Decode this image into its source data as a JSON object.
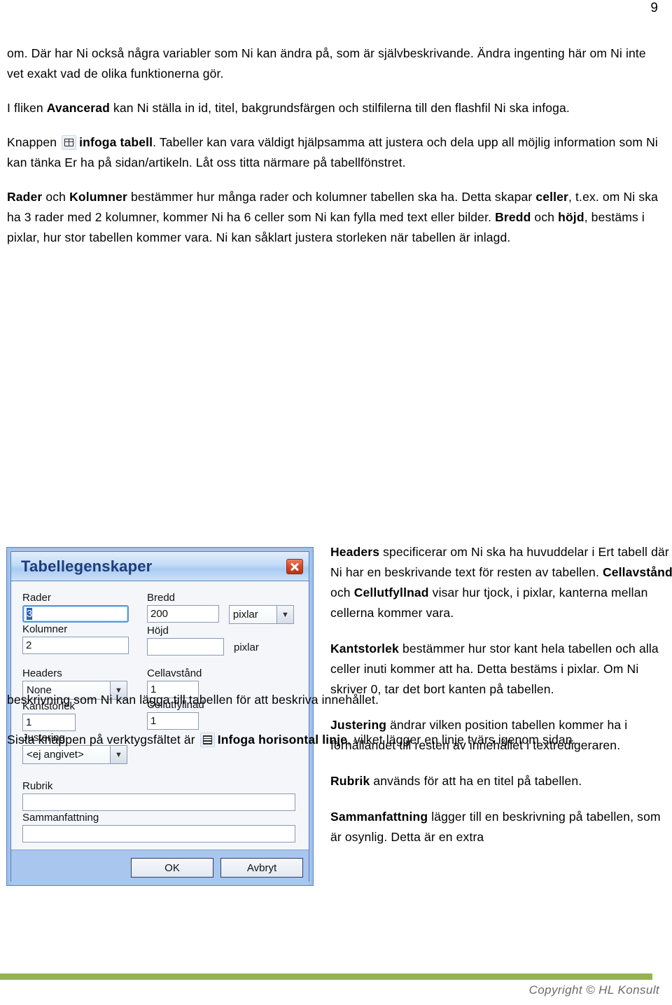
{
  "page": {
    "number": "9"
  },
  "paragraphs": {
    "p1_a": "om. Där har Ni också några variabler som Ni kan ändra på, som är självbeskrivande. Ändra ingenting här om Ni inte vet exakt vad de olika funktionerna gör.",
    "p2_a": "I fliken ",
    "p2_b": "Avancerad",
    "p2_c": " kan Ni ställa in id, titel, bakgrundsfärgen och stilfilerna till den flashfil Ni ska infoga.",
    "p3_a": "Knappen ",
    "p3_b": "infoga tabell",
    "p3_c": ". Tabeller kan vara väldigt hjälpsamma att justera och dela upp all möjlig information som Ni kan tänka Er ha på sidan/artikeln. Låt oss titta närmare på tabellfönstret.",
    "p4_a": "Rader",
    "p4_b": " och ",
    "p4_c": "Kolumner",
    "p4_d": " bestämmer hur många rader och kolumner tabellen ska ha. Detta skapar ",
    "p4_e": "celler",
    "p4_f": ", t.ex. om Ni ska ha 3 rader med 2 kolumner, kommer Ni ha 6 celler som Ni kan fylla med text eller bilder. ",
    "p4_g": "Bredd",
    "p4_h": " och ",
    "p4_i": "höjd",
    "p4_j": ", bestäms i pixlar, hur stor tabellen kommer vara. Ni kan såklart justera storleken när tabellen är inlagd.",
    "s1_a": "Headers",
    "s1_b": " specificerar om Ni ska ha huvuddelar i Ert tabell där Ni har en beskrivande text för resten av tabellen. ",
    "s1_c": "Cellavstånd",
    "s1_d": " och ",
    "s1_e": "Cellutfyllnad",
    "s1_f": " visar hur tjock, i pixlar, kanterna mellan cellerna kommer vara.",
    "s2_a": "Kantstorlek",
    "s2_b": " bestämmer hur stor kant hela tabellen och alla celler inuti kommer att ha. Detta bestäms i pixlar. Om Ni skriver 0, tar det bort kanten på tabellen.",
    "s3_a": "Justering",
    "s3_b": " ändrar vilken position tabellen kommer ha i förhållandet till resten av innehållet i textredigeraren.",
    "s4_a": "Rubrik",
    "s4_b": " används för att ha en titel på tabellen.",
    "s5_a": "Sammanfattning",
    "s5_b": " lägger till en beskrivning på tabellen, som är osynlig. Detta är en extra",
    "p5_a": "beskrivning som Ni kan lägga till tabellen för att beskriva innehållet.",
    "p6_a": "Sista knappen på verktygsfältet är ",
    "p6_b": "Infoga horisontal linje",
    "p6_c": ", vilket lägger en linje tvärs igenom sidan."
  },
  "dialog": {
    "title": "Tabellegenskaper",
    "close_label": "×",
    "fields": {
      "rader_label": "Rader",
      "rader_value": "3",
      "kolumner_label": "Kolumner",
      "kolumner_value": "2",
      "bredd_label": "Bredd",
      "bredd_value": "200",
      "bredd_unit": "pixlar",
      "hojd_label": "Höjd",
      "hojd_value": "",
      "hojd_unit": "pixlar",
      "headers_label": "Headers",
      "headers_value": "None",
      "cellavstand_label": "Cellavstånd",
      "cellavstand_value": "1",
      "kantstorlek_label": "Kantstorlek",
      "kantstorlek_value": "1",
      "cellutfyllnad_label": "Cellutfyllnad",
      "cellutfyllnad_value": "1",
      "justering_label": "Justering",
      "justering_value": "<ej angivet>",
      "rubrik_label": "Rubrik",
      "rubrik_value": "",
      "sammanfattning_label": "Sammanfattning",
      "sammanfattning_value": ""
    },
    "buttons": {
      "ok": "OK",
      "cancel": "Avbryt"
    },
    "arrow_glyph": "▼"
  },
  "footer": {
    "copyright": "Copyright © HL Konsult",
    "bar_color": "#94b356"
  }
}
